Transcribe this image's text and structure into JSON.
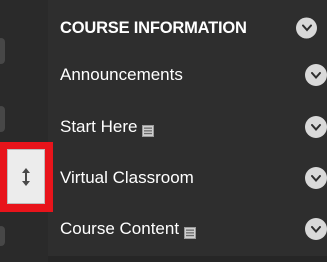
{
  "menu": {
    "header": {
      "label": "COURSE INFORMATION",
      "icon": "chevron-down-icon"
    },
    "items": [
      {
        "label": "Announcements",
        "hidden_indicator": false,
        "icon": "chevron-down-icon"
      },
      {
        "label": "Start Here",
        "hidden_indicator": true,
        "icon": "chevron-down-icon"
      },
      {
        "label": "Virtual Classroom",
        "hidden_indicator": false,
        "icon": "chevron-down-icon"
      },
      {
        "label": "Course Content",
        "hidden_indicator": true,
        "icon": "chevron-down-icon"
      }
    ]
  },
  "reorder_handle": {
    "icon": "up-down-arrow-icon",
    "highlight_color": "#e8141b"
  },
  "colors": {
    "background": "#2e2e2e",
    "text": "#ffffff",
    "chevron_bg": "#d9d9d9"
  }
}
